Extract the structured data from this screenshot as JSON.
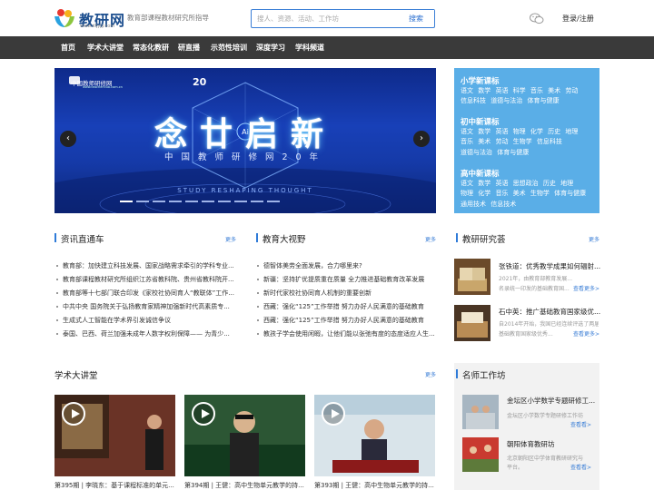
{
  "header": {
    "logo_text": "教研网",
    "logo_url": "www.dljyjy.com",
    "slogan": "教育部课程教材研究所指导",
    "search_placeholder": "搜人、资源、活动、工作坊",
    "search_button": "搜索",
    "login": "登录/注册"
  },
  "nav": [
    "首页",
    "学术大讲堂",
    "常态化教研",
    "研直播",
    "示范性培训",
    "深度学习",
    "学科频道"
  ],
  "banner": {
    "org": "中国教师研修网",
    "org_url": "www.teacherclub.com.cn",
    "badge": "20",
    "title": "念廿启新",
    "ai_badge": "Ai",
    "subtitle": "中国教师研修网20年",
    "tagline": "STUDY RESHAPING THOUGHT",
    "prev": "‹",
    "next": "›",
    "slide_count": 10
  },
  "categories": [
    {
      "heading": "小学新课标",
      "lines": [
        "语文 数学 英语 科学 音乐 美术 劳动",
        "信息科技 道德与法治 体育与健康"
      ]
    },
    {
      "heading": "初中新课标",
      "lines": [
        "语文 数学 英语 物理 化学 历史 地理",
        "音乐 美术 劳动 生物学 信息科技",
        "道德与法治 体育与健康"
      ]
    },
    {
      "heading": "高中新课标",
      "lines": [
        "语文 数学 英语 思想政治 历史 地理",
        "物理 化学 音乐 美术 生物学 体育与健康",
        "通用技术 信息技术"
      ]
    }
  ],
  "news_section": {
    "title": "资讯直通车",
    "more": "更多",
    "items": [
      "教育部：加快建立科技发展、国家战略需求牵引的学科专业...",
      "教育部课程教材研究所组织江苏省教科院、贵州省教科院开...",
      "教育部等十七部门联合印发《家校社协同育人“教联体”工作...",
      "中共中央 国务院关于弘扬教育家精神加强新时代高素质专...",
      "生成式人工智能在学术界引发诚信争议",
      "泰国、巴西、荷兰加强未成年人数字权利保障—— 为青少..."
    ]
  },
  "vision_section": {
    "title": "教育大视野",
    "more": "更多",
    "items": [
      "德智体美劳全面发展，合力哪里来?",
      "新疆：坚持扩优提质重在质量 全力推进基础教育改革发展",
      "新时代家校社协同育人机制的重要创新",
      "西藏：强化“125”工作举措 努力办好人民满意的基础教育",
      "西藏：强化“125”工作举措 努力办好人民满意的基础教育",
      "教孩子学会使用闲暇，让他们能以张弛有度的态度适应人生..."
    ]
  },
  "research_section": {
    "title": "教研研究荟",
    "more": "更多",
    "items": [
      {
        "title": "张铁道：优秀教学成果如何辐射...",
        "desc1": "2021年，由教育部教育发展...",
        "desc2": "名录统一印发的基础教育国...",
        "more": "查看更多>"
      },
      {
        "title": "石中英：推广基础教育国家级优...",
        "desc1": "自2014年开始，我国已经连续评选了两届",
        "desc2": "基础教育国家级优秀...",
        "more": "查看更多>"
      }
    ]
  },
  "lecture_section": {
    "title": "学术大讲堂",
    "more": "更多",
    "items": [
      "第395期 | 李晓东：基于课程标准的单元...",
      "第394期 | 王健：高中生物单元教学的持...",
      "第393期 | 王健：高中生物单元教学的持..."
    ]
  },
  "teacher_section": {
    "title": "名师工作坊",
    "items": [
      {
        "title": "金坛区小学数学专题研修工...",
        "desc": "金坛区小学数学专题研修工作坊",
        "more": "查看看>"
      },
      {
        "title": "朝阳体育教研坊",
        "desc1": "北京朝阳区中学体育教研研究与",
        "desc2": "平台。",
        "more": "查看看>"
      }
    ]
  },
  "colors": {
    "nav_bg": "#3a3a3a",
    "accent": "#2f7bd8",
    "category_bg": "#5aaee7"
  }
}
